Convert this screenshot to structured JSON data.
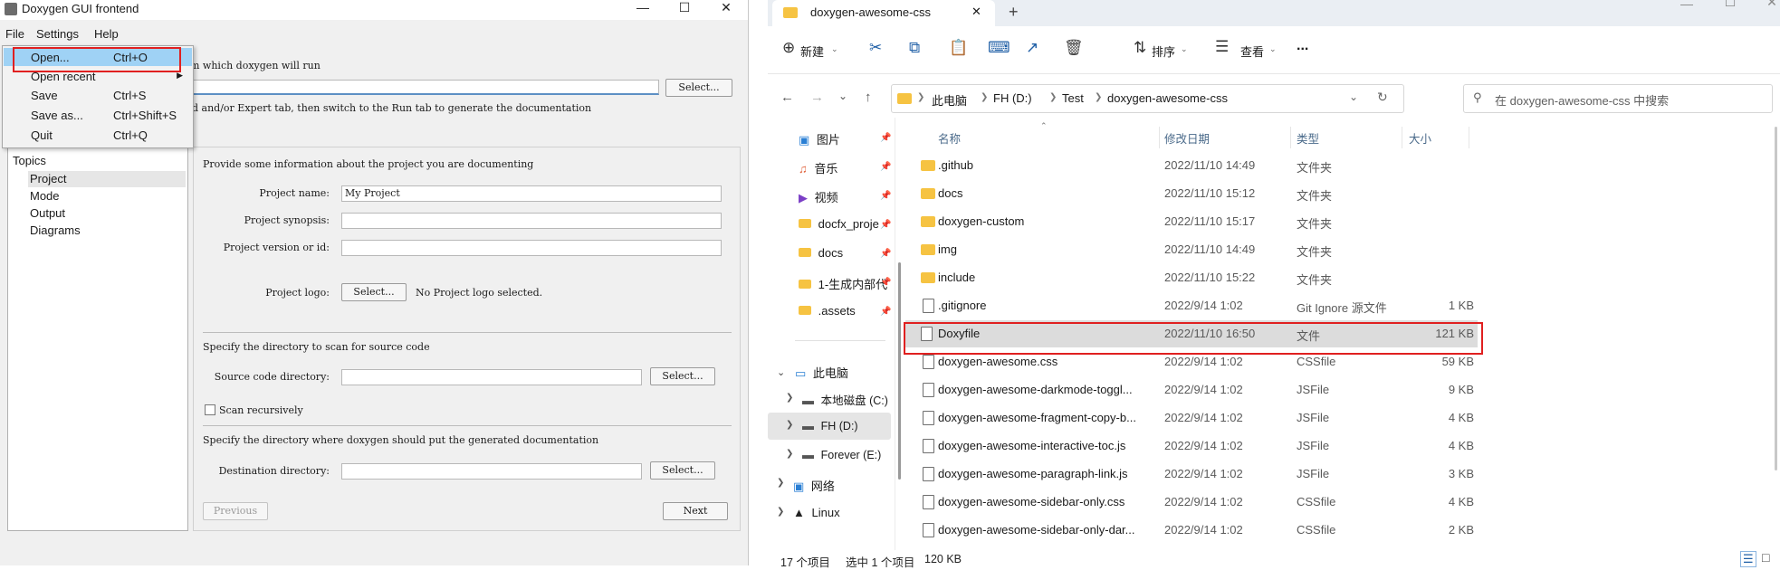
{
  "doxygen": {
    "title": "Doxygen GUI frontend",
    "menubar": [
      "File",
      "Settings",
      "Help"
    ],
    "file_menu": [
      {
        "label": "Open...",
        "shortcut": "Ctrl+O"
      },
      {
        "label": "Open recent",
        "shortcut": ""
      },
      {
        "label": "Save",
        "shortcut": "Ctrl+S"
      },
      {
        "label": "Save as...",
        "shortcut": "Ctrl+Shift+S"
      },
      {
        "label": "Quit",
        "shortcut": "Ctrl+Q"
      }
    ],
    "step1_partial": "m which doxygen will run",
    "select_button": "Select...",
    "step2_partial": "d and/or Expert tab, then switch to the Run tab to generate the documentation",
    "topics": {
      "heading": "Topics",
      "items": [
        "Project",
        "Mode",
        "Output",
        "Diagrams"
      ],
      "selected": "Project"
    },
    "project": {
      "intro": "Provide some information about the project you are documenting",
      "name_label": "Project name:",
      "name_value": "My Project",
      "synopsis_label": "Project synopsis:",
      "version_label": "Project version or id:",
      "logo_label": "Project logo:",
      "logo_button": "Select...",
      "logo_status": "No Project logo selected.",
      "source_intro": "Specify the directory to scan for source code",
      "source_label": "Source code directory:",
      "source_button": "Select...",
      "scan_recursive": "Scan recursively",
      "dest_intro": "Specify the directory where doxygen should put the generated documentation",
      "dest_label": "Destination directory:",
      "dest_button": "Select...",
      "previous": "Previous",
      "next": "Next"
    }
  },
  "explorer": {
    "tab_title": "doxygen-awesome-css",
    "toolbar": {
      "new": "新建",
      "sort": "排序",
      "view": "查看",
      "more": "..."
    },
    "breadcrumb": [
      "此电脑",
      "FH (D:)",
      "Test",
      "doxygen-awesome-css"
    ],
    "search_placeholder": "在 doxygen-awesome-css 中搜索",
    "sidebar": [
      {
        "label": "图片",
        "icon": "pictures-icon"
      },
      {
        "label": "音乐",
        "icon": "music-icon"
      },
      {
        "label": "视频",
        "icon": "videos-icon"
      },
      {
        "label": "docfx_proje",
        "icon": "folder-icon"
      },
      {
        "label": "docs",
        "icon": "folder-icon"
      },
      {
        "label": "1-生成内部代",
        "icon": "folder-icon"
      },
      {
        "label": ".assets",
        "icon": "folder-icon"
      }
    ],
    "tree": [
      {
        "label": "此电脑",
        "icon": "pc-icon"
      },
      {
        "label": "本地磁盘 (C:)",
        "icon": "drive-icon"
      },
      {
        "label": "FH (D:)",
        "icon": "drive-icon"
      },
      {
        "label": "Forever (E:)",
        "icon": "drive-icon"
      },
      {
        "label": "网络",
        "icon": "network-icon"
      },
      {
        "label": "Linux",
        "icon": "linux-icon"
      }
    ],
    "columns": [
      "名称",
      "修改日期",
      "类型",
      "大小"
    ],
    "files": [
      {
        "name": ".github",
        "date": "2022/11/10 14:49",
        "type": "文件夹",
        "size": "",
        "kind": "folder"
      },
      {
        "name": "docs",
        "date": "2022/11/10 15:12",
        "type": "文件夹",
        "size": "",
        "kind": "folder"
      },
      {
        "name": "doxygen-custom",
        "date": "2022/11/10 15:17",
        "type": "文件夹",
        "size": "",
        "kind": "folder"
      },
      {
        "name": "img",
        "date": "2022/11/10 14:49",
        "type": "文件夹",
        "size": "",
        "kind": "folder"
      },
      {
        "name": "include",
        "date": "2022/11/10 15:22",
        "type": "文件夹",
        "size": "",
        "kind": "folder"
      },
      {
        "name": ".gitignore",
        "date": "2022/9/14 1:02",
        "type": "Git Ignore 源文件",
        "size": "1 KB",
        "kind": "file"
      },
      {
        "name": "Doxyfile",
        "date": "2022/11/10 16:50",
        "type": "文件",
        "size": "121 KB",
        "kind": "file"
      },
      {
        "name": "doxygen-awesome.css",
        "date": "2022/9/14 1:02",
        "type": "CSSfile",
        "size": "59 KB",
        "kind": "file"
      },
      {
        "name": "doxygen-awesome-darkmode-toggl...",
        "date": "2022/9/14 1:02",
        "type": "JSFile",
        "size": "9 KB",
        "kind": "file"
      },
      {
        "name": "doxygen-awesome-fragment-copy-b...",
        "date": "2022/9/14 1:02",
        "type": "JSFile",
        "size": "4 KB",
        "kind": "file"
      },
      {
        "name": "doxygen-awesome-interactive-toc.js",
        "date": "2022/9/14 1:02",
        "type": "JSFile",
        "size": "4 KB",
        "kind": "file"
      },
      {
        "name": "doxygen-awesome-paragraph-link.js",
        "date": "2022/9/14 1:02",
        "type": "JSFile",
        "size": "3 KB",
        "kind": "file"
      },
      {
        "name": "doxygen-awesome-sidebar-only.css",
        "date": "2022/9/14 1:02",
        "type": "CSSfile",
        "size": "4 KB",
        "kind": "file"
      },
      {
        "name": "doxygen-awesome-sidebar-only-dar...",
        "date": "2022/9/14 1:02",
        "type": "CSSfile",
        "size": "2 KB",
        "kind": "file"
      }
    ],
    "selected_file": "Doxyfile",
    "status": {
      "count": "17 个项目",
      "selected": "选中 1 个项目",
      "size": "120 KB"
    }
  }
}
